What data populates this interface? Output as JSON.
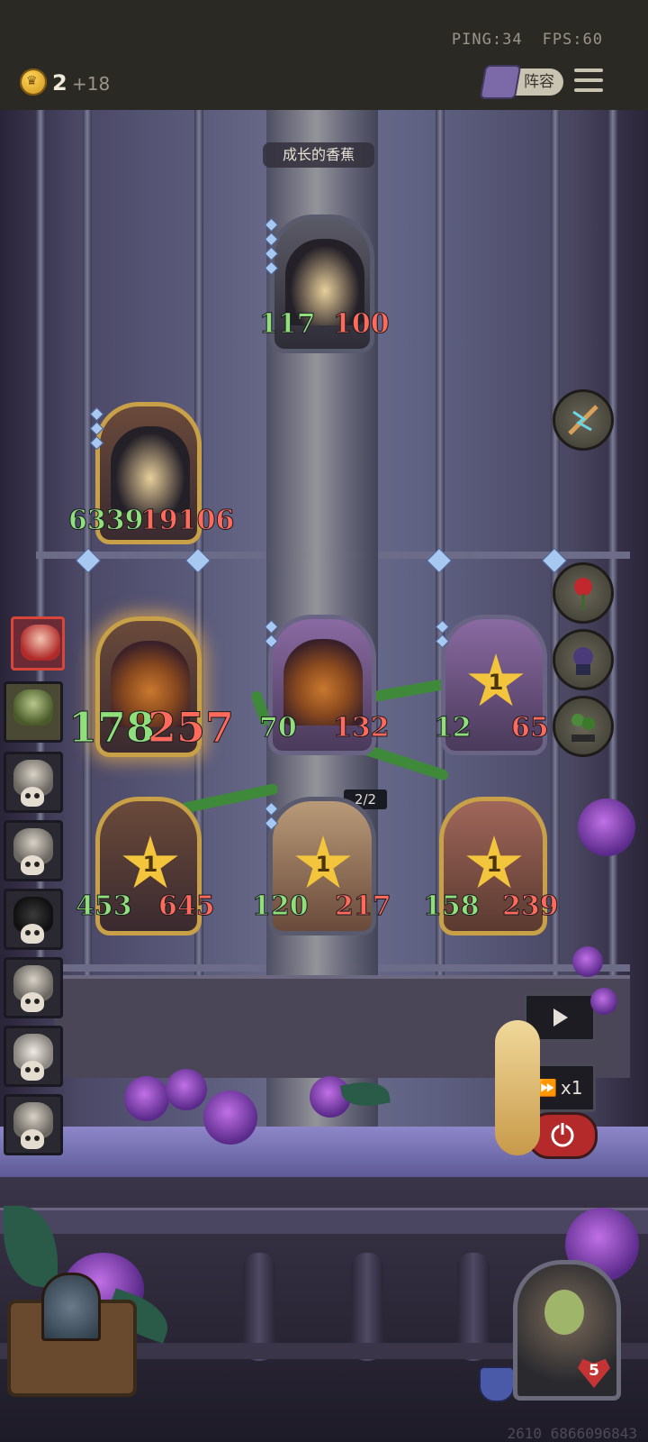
{
  "status": {
    "ping": "PING:34",
    "fps": "FPS:60"
  },
  "currency": {
    "count": "2",
    "income": "+18"
  },
  "lineup_button": {
    "label": "阵容"
  },
  "board": {
    "enemy_name": "成长的香蕉",
    "enemy_cards": [
      {
        "name": "dragon-enemy-top",
        "atk": "117",
        "hp": "100"
      },
      {
        "name": "dragon-enemy-big",
        "atk": "6339",
        "hp": "19106"
      }
    ],
    "player_cards": [
      {
        "name": "pumpkin-selected",
        "atk": "178",
        "hp": "257"
      },
      {
        "name": "pumpkin",
        "atk": "70",
        "hp": "132"
      },
      {
        "name": "cactus",
        "atk": "12",
        "hp": "65",
        "level": "1"
      },
      {
        "name": "tree-stump",
        "atk": "453",
        "hp": "645",
        "level": "1"
      },
      {
        "name": "mushroom-cat",
        "atk": "120",
        "hp": "217",
        "level": "1"
      },
      {
        "name": "stone-guardian",
        "atk": "158",
        "hp": "239",
        "level": "1"
      }
    ],
    "card_counter": "2/2"
  },
  "controls": {
    "speed_label": "x1"
  },
  "hero": {
    "health": "5"
  },
  "seed_id": "2610 6866096843",
  "icons": [
    "crown-coin-icon",
    "book-icon",
    "menu-icon",
    "play-icon",
    "fast-forward-icon",
    "power-icon",
    "skull-icon",
    "rose-icon",
    "shield-icon",
    "heart-icon"
  ]
}
